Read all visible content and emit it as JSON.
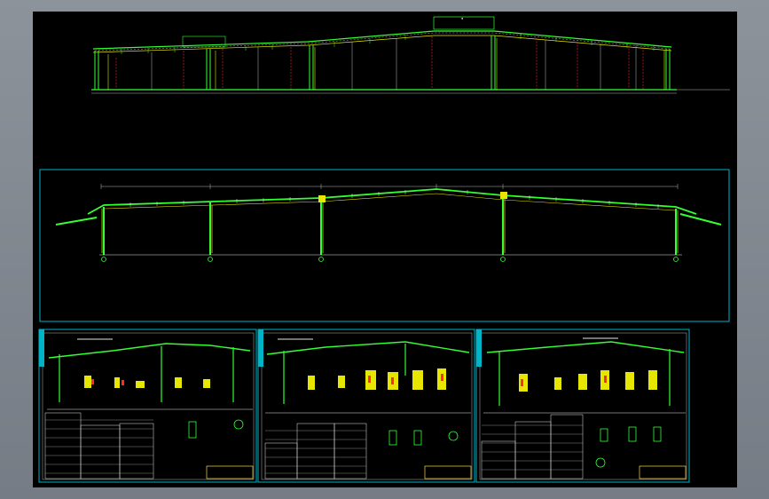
{
  "viewer": {
    "background_color": "#000000",
    "frame_color": "#808890"
  },
  "drawing": {
    "line_green": "#33ff33",
    "line_yellow": "#e6e600",
    "line_red": "#ff2a2a",
    "line_white": "#e6e6e6",
    "frame_cyan": "#00b4c8",
    "title_block_color": "#ffd84a",
    "icons": [
      "elevation-view",
      "frame-section-view",
      "detail-sheet"
    ],
    "views": [
      {
        "id": "elevation"
      },
      {
        "id": "main-frame"
      },
      {
        "id": "sheet-1"
      },
      {
        "id": "sheet-2"
      },
      {
        "id": "sheet-3"
      }
    ]
  }
}
